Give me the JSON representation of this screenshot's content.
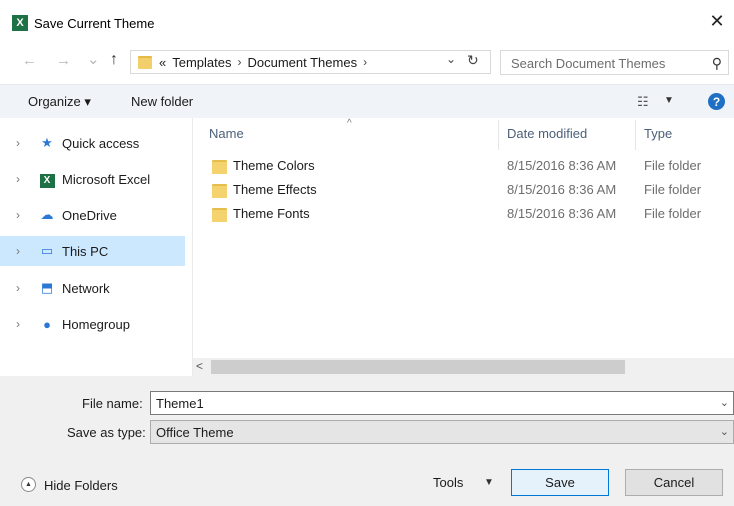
{
  "window": {
    "title": "Save Current Theme",
    "app_icon_letter": "X",
    "close_glyph": "✕"
  },
  "nav": {
    "back_glyph": "←",
    "forward_glyph": "→",
    "recent_glyph": "⌄",
    "up_glyph": "↑",
    "address": {
      "overflow": "«",
      "crumbs": [
        "Templates",
        "Document Themes"
      ],
      "separator": "›",
      "dropdown_glyph": "⌄",
      "refresh_glyph": "↻"
    },
    "search": {
      "placeholder": "Search Document Themes",
      "icon_glyph": "⚲"
    }
  },
  "toolbar": {
    "organize_label": "Organize ▾",
    "new_folder_label": "New folder",
    "view_glyph": "☷",
    "view_dd_glyph": "▼",
    "help_glyph": "?"
  },
  "sidebar": {
    "chevron": "›",
    "items": [
      {
        "label": "Quick access",
        "icon": "★",
        "color": "#2b78d4",
        "selected": false
      },
      {
        "label": "Microsoft Excel",
        "icon": "X",
        "color": "#1e7145",
        "selected": false
      },
      {
        "label": "OneDrive",
        "icon": "☁",
        "color": "#2b78d4",
        "selected": false
      },
      {
        "label": "This PC",
        "icon": "▭",
        "color": "#2b78d4",
        "selected": true
      },
      {
        "label": "Network",
        "icon": "⬒",
        "color": "#2b78d4",
        "selected": false
      },
      {
        "label": "Homegroup",
        "icon": "●",
        "color": "#2b78d4",
        "selected": false
      }
    ]
  },
  "filelist": {
    "sort_glyph": "^",
    "columns": [
      "Name",
      "Date modified",
      "Type"
    ],
    "rows": [
      {
        "name": "Theme Colors",
        "date": "8/15/2016 8:36 AM",
        "type": "File folder"
      },
      {
        "name": "Theme Effects",
        "date": "8/15/2016 8:36 AM",
        "type": "File folder"
      },
      {
        "name": "Theme Fonts",
        "date": "8/15/2016 8:36 AM",
        "type": "File folder"
      }
    ]
  },
  "scrollbar": {
    "left_glyph": "<"
  },
  "form": {
    "file_name_label": "File name:",
    "file_name_value": "Theme1",
    "save_type_label": "Save as type:",
    "save_type_value": "Office Theme",
    "dropdown_glyph": "⌄"
  },
  "footer": {
    "hide_folders_glyph": "▲",
    "hide_folders_label": "Hide Folders",
    "tools_label": "Tools",
    "tools_dd_glyph": "▼",
    "save_label": "Save",
    "cancel_label": "Cancel"
  },
  "colors": {
    "accent": "#0078d7",
    "selection": "#cce8ff",
    "toolbar_bg": "#f0f4f9",
    "folder": "#f4d36f",
    "excel": "#1e7145",
    "help": "#1f6fc5"
  }
}
